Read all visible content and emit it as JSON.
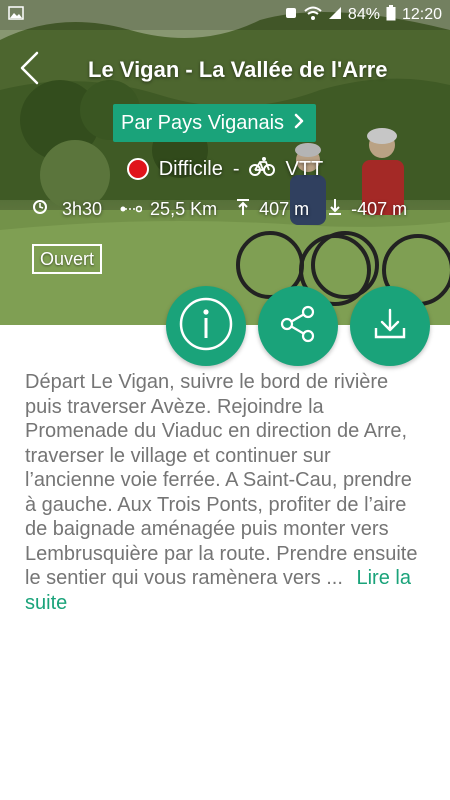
{
  "status_bar": {
    "battery": "84%",
    "time": "12:20"
  },
  "header": {
    "title": "Le Vigan - La Vallée de l'Arre"
  },
  "operator": {
    "label": "Par Pays Viganais"
  },
  "trail": {
    "difficulty": "Difficile",
    "separator": "-",
    "activity": "VTT",
    "duration": "3h30",
    "distance": "25,5 Km",
    "ascent": "407 m",
    "descent": "-407 m",
    "status": "Ouvert"
  },
  "colors": {
    "accent": "#1aa37a",
    "difficulty": "#e0141b",
    "text_muted": "#757575"
  },
  "icons": [
    "back-icon",
    "chevron-right-icon",
    "bike-icon",
    "clock-icon",
    "distance-icon",
    "ascent-icon",
    "descent-icon",
    "info-icon",
    "share-icon",
    "download-icon"
  ],
  "description": {
    "text": "Départ Le Vigan, suivre le bord de rivière puis traverser Avèze. Rejoindre la Promenade du Viaduc en direction de Arre, traverser le village et continuer sur l’ancienne voie ferrée. A Saint-Cau, prendre à gauche. Aux Trois Ponts, profiter de l’aire de baignade aménagée puis monter vers Lembrusquière par la route. Prendre ensuite le sentier qui vous ramènera vers ...",
    "read_more": "Lire la suite"
  }
}
